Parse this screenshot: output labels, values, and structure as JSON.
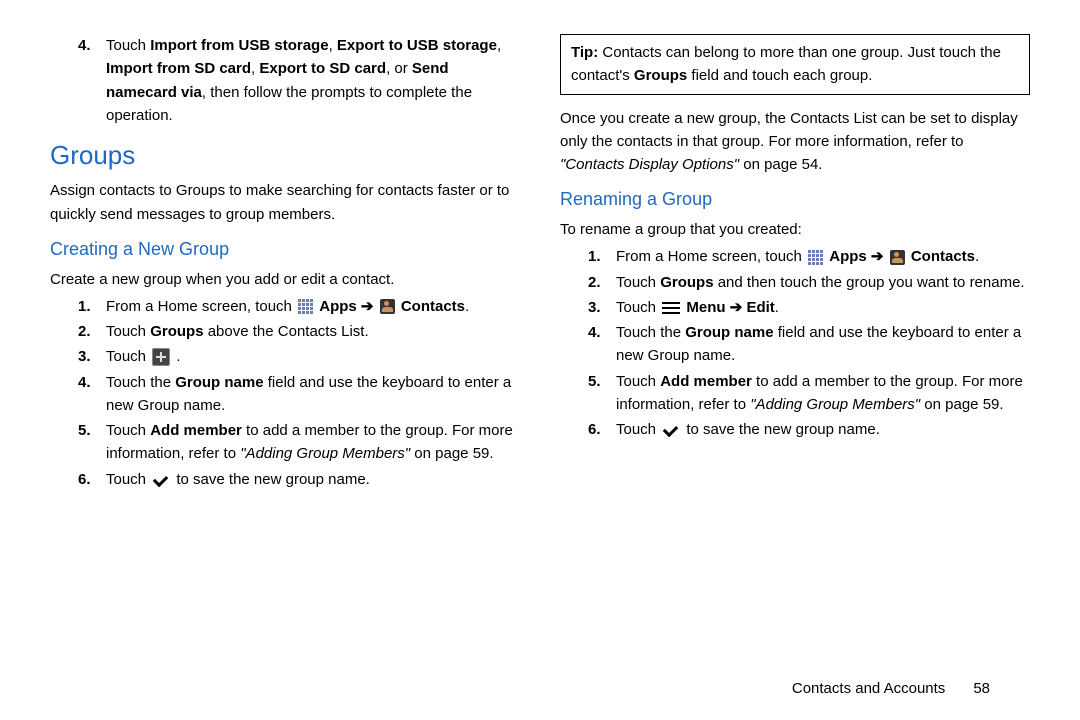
{
  "left": {
    "step4": {
      "num": "4.",
      "pre": "Touch ",
      "b1": "Import from USB storage",
      "sep1": ", ",
      "b2": "Export to USB storage",
      "sep2": ", ",
      "b3": "Import from SD card",
      "sep3": ", ",
      "b4": "Export to SD card",
      "sep4": ", or ",
      "b5": "Send namecard via",
      "post": ", then follow the prompts to complete the operation."
    },
    "groups_h": "Groups",
    "groups_p": "Assign contacts to Groups to make searching for contacts faster or to quickly send messages to group members.",
    "creating_h": "Creating a New Group",
    "creating_p": "Create a new group when you add or edit a contact.",
    "s1": {
      "num": "1.",
      "t1": "From a Home screen, touch ",
      "apps": "Apps",
      "arrow": " ➔ ",
      "contacts": "Contacts",
      "end": "."
    },
    "s2": {
      "num": "2.",
      "t1": "Touch ",
      "b": "Groups",
      "t2": " above the Contacts List."
    },
    "s3": {
      "num": "3.",
      "t1": "Touch ",
      "end": " ."
    },
    "s4": {
      "num": "4.",
      "t1": "Touch the ",
      "b": "Group name",
      "t2": " field and use the keyboard to enter a new Group name."
    },
    "s5": {
      "num": "5.",
      "t1": "Touch ",
      "b": "Add member",
      "t2": " to add a member to the group. For more information, refer to ",
      "it": "\"Adding Group Members\"",
      "t3": " on page 59."
    },
    "s6": {
      "num": "6.",
      "t1": "Touch ",
      "t2": " to save the new group name."
    }
  },
  "right": {
    "tip": {
      "label": "Tip:",
      "t1": " Contacts can belong to more than one group. Just touch the contact's ",
      "b": "Groups",
      "t2": " field and touch each group."
    },
    "para": {
      "t1": "Once you create a new group, the Contacts List can be set to display only the contacts in that group. For more information, refer to ",
      "it": "\"Contacts Display Options\"",
      "t2": "  on page 54."
    },
    "rename_h": "Renaming a Group",
    "rename_p": "To rename a group that you created:",
    "s1": {
      "num": "1.",
      "t1": "From a Home screen, touch ",
      "apps": "Apps",
      "arrow": " ➔ ",
      "contacts": "Contacts",
      "end": "."
    },
    "s2": {
      "num": "2.",
      "t1": "Touch ",
      "b": "Groups",
      "t2": " and then touch the group you want to rename."
    },
    "s3": {
      "num": "3.",
      "t1": "Touch ",
      "menu": "Menu",
      "arrow": " ➔ ",
      "edit": "Edit",
      "end": "."
    },
    "s4": {
      "num": "4.",
      "t1": "Touch the ",
      "b": "Group name",
      "t2": " field and use the keyboard to enter a new Group name."
    },
    "s5": {
      "num": "5.",
      "t1": "Touch ",
      "b": "Add member",
      "t2": " to add a member to the group. For more information, refer to ",
      "it": "\"Adding Group Members\"",
      "t3": " on page 59."
    },
    "s6": {
      "num": "6.",
      "t1": "Touch ",
      "t2": " to save the new group name."
    }
  },
  "footer": {
    "section": "Contacts and Accounts",
    "page": "58"
  }
}
